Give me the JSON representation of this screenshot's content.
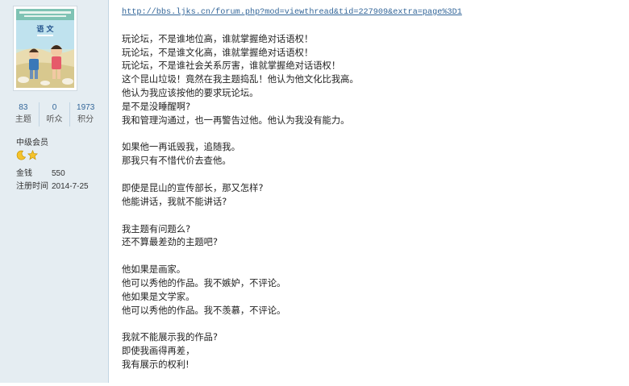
{
  "profile": {
    "book_cover_title": "语 文",
    "stats": [
      {
        "value": "83",
        "label": "主题"
      },
      {
        "value": "0",
        "label": "听众"
      },
      {
        "value": "1973",
        "label": "积分"
      }
    ],
    "rank": "中级会员",
    "rank_icons": [
      "moon-icon",
      "star-icon"
    ],
    "money_label": "金钱",
    "money_value": "550",
    "register_label": "注册时间",
    "register_value": "2014-7-25"
  },
  "post": {
    "link": "http://bbs.ljks.cn/forum.php?mod=viewthread&tid=227909&extra=page%3D1",
    "paragraphs": [
      [
        "玩论坛，不是谁地位高，谁就掌握绝对话语权！",
        "玩论坛，不是谁文化高，谁就掌握绝对话语权！",
        "玩论坛，不是谁社会关系厉害，谁就掌握绝对话语权！",
        "这个昆山垃圾！竟然在我主题捣乱！他认为他文化比我高。",
        "他认为我应该按他的要求玩论坛。",
        "是不是没睡醒啊?",
        "我和管理沟通过，也一再警告过他。他认为我没有能力。"
      ],
      [
        "如果他一再诋毁我，追随我。",
        "那我只有不惜代价去查他。"
      ],
      [
        "即使是昆山的宣传部长，那又怎样?",
        "他能讲话，我就不能讲话?"
      ],
      [
        "我主题有问题么?",
        "还不算最差劲的主题吧?"
      ],
      [
        "他如果是画家。",
        "他可以秀他的作品。我不嫉妒，不评论。",
        "他如果是文学家。",
        "他可以秀他的作品。我不羡慕，不评论。"
      ],
      [
        "我就不能展示我的作品?",
        "即使我画得再差，",
        "我有展示的权利!"
      ]
    ]
  }
}
